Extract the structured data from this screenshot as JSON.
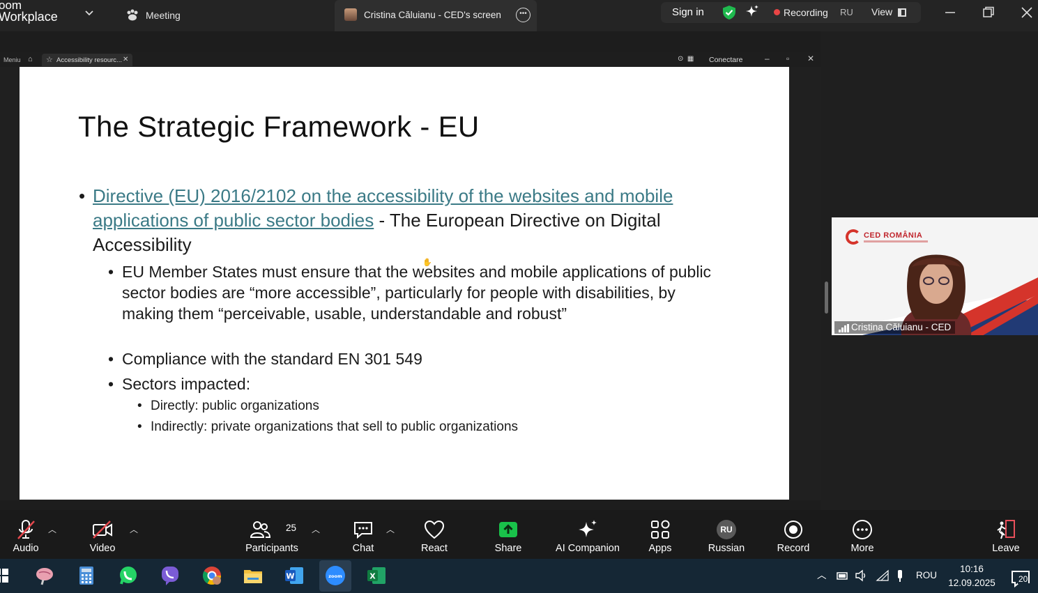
{
  "app": {
    "title_line1": "oom",
    "title_line2": "Workplace"
  },
  "tabs": {
    "meeting_label": "Meeting",
    "screen_label": "Cristina Căluianu - CED's screen"
  },
  "topbar": {
    "sign_in": "Sign in",
    "recording_label": "Recording",
    "language": "RU",
    "view_label": "View",
    "colors": {
      "shield": "#1fb94e",
      "recording_dot": "#e94545"
    }
  },
  "browser": {
    "menu_label": "Meniu",
    "tab_title": "Accessibility resourc...",
    "connect_label": "Conectare"
  },
  "slide": {
    "title": "The Strategic Framework - EU",
    "bullet1_link": "Directive (EU) 2016/2102 on the accessibility of the websites and mobile applications of public sector bodies",
    "bullet1_text": " - The European Directive on Digital Accessibility",
    "sub1": "EU Member States must ensure that the websites and mobile applications of public sector bodies are “more accessible”, particularly for people with disabilities, by making them “perceivable, usable, understandable and robust”",
    "sub2": "Compliance with the standard EN 301 549",
    "sub3": "Sectors impacted:",
    "sub3_items": [
      "Directly: public organizations",
      "Indirectly: private organizations that sell to public organizations"
    ],
    "link_color": "#3b7a86"
  },
  "video_tile": {
    "participant_name": "Cristina Căluianu - CED",
    "logo_text": "CED ROMÂNIA"
  },
  "toolbar": {
    "audio": "Audio",
    "video": "Video",
    "participants": "Participants",
    "participants_count": "25",
    "chat": "Chat",
    "react": "React",
    "share": "Share",
    "ai_companion": "AI Companion",
    "apps": "Apps",
    "russian": "Russian",
    "russian_badge": "RU",
    "record": "Record",
    "more": "More",
    "leave": "Leave",
    "colors": {
      "share": "#19c24a",
      "leave": "#e8505b"
    }
  },
  "taskbar": {
    "language": "ROU",
    "time": "10:16",
    "date": "12.09.2025",
    "notification_count": "20"
  }
}
